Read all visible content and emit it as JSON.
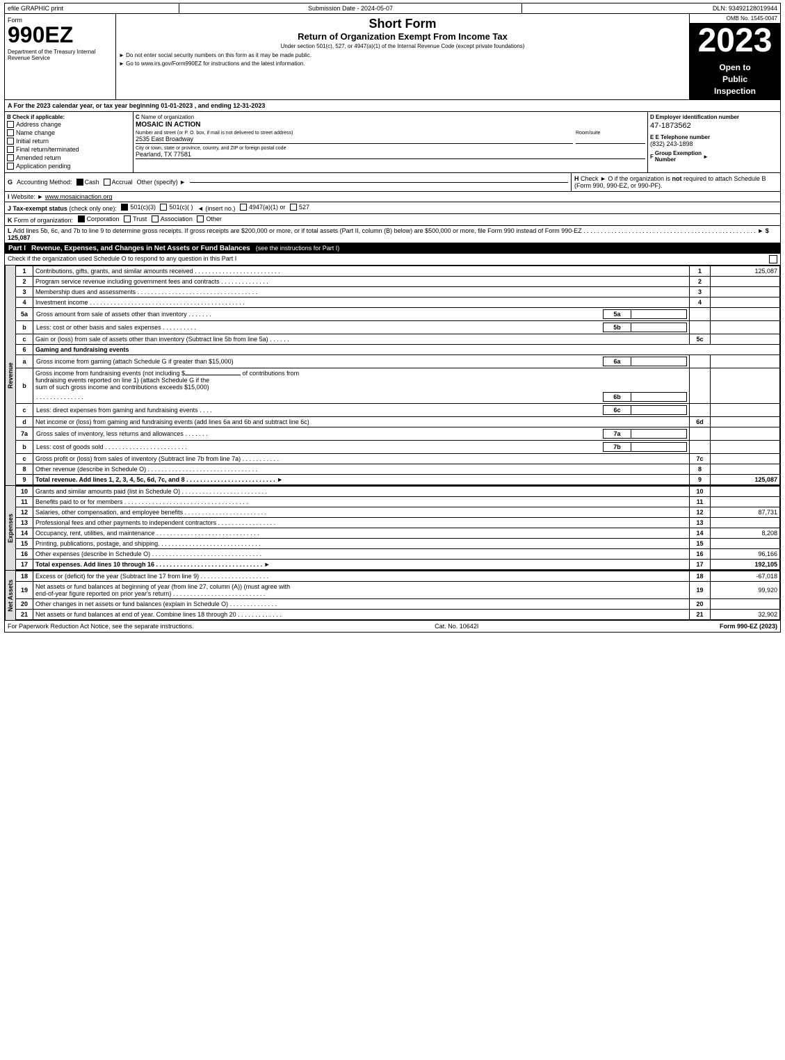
{
  "header": {
    "efile": "efile GRAPHIC print",
    "submission": "Submission Date - 2024-05-07",
    "dln": "DLN: 93492128019944",
    "omb": "OMB No. 1545-0047",
    "form_label": "Form",
    "form_number": "990EZ",
    "short_form": "Short Form",
    "return_title": "Return of Organization Exempt From Income Tax",
    "under_section": "Under section 501(c), 527, or 4947(a)(1) of the Internal Revenue Code (except private foundations)",
    "do_not_enter": "► Do not enter social security numbers on this form as it may be made public.",
    "go_to": "► Go to www.irs.gov/Form990EZ for instructions and the latest information.",
    "year": "2023",
    "open_public": "Open to\nPublic\nInspection",
    "dept": "Department of the Treasury\nInternal Revenue\nService"
  },
  "section_a": {
    "label": "A",
    "text": "For the 2023 calendar year, or tax year beginning 01-01-2023 , and ending 12-31-2023"
  },
  "section_b": {
    "label": "B",
    "title": "Check if applicable:",
    "items": [
      {
        "label": "Address change",
        "checked": false
      },
      {
        "label": "Name change",
        "checked": false
      },
      {
        "label": "Initial return",
        "checked": false
      },
      {
        "label": "Final return/terminated",
        "checked": false
      },
      {
        "label": "Amended return",
        "checked": false
      },
      {
        "label": "Application pending",
        "checked": false
      }
    ]
  },
  "section_c": {
    "label": "C",
    "name_label": "Name of organization",
    "org_name": "MOSAIC IN ACTION",
    "address_label": "Number and street (or P. O. box, if mail is not delivered to street address)",
    "address": "2535 East Broadway",
    "room_label": "Room/suite",
    "room": "",
    "city_label": "City or town, state or province, country, and ZIP or foreign postal code",
    "city": "Pearland, TX  77581"
  },
  "section_d": {
    "label": "D",
    "ein_label": "Employer identification number",
    "ein": "47-1873562",
    "phone_label": "E Telephone number",
    "phone": "(832) 243-1898",
    "group_label": "F Group Exemption\nNumber",
    "group_arrow": "►"
  },
  "section_g": {
    "label": "G",
    "text": "Accounting Method:",
    "cash_label": "Cash",
    "cash_checked": true,
    "accrual_label": "Accrual",
    "accrual_checked": false,
    "other_label": "Other (specify) ►"
  },
  "section_h": {
    "label": "H",
    "text": "Check ►  O if the organization is not required to attach Schedule B\n(Form 990, 990-EZ, or 990-PF)."
  },
  "section_i": {
    "label": "I",
    "text": "Website: ►www.mosaicinaction.org"
  },
  "section_j": {
    "label": "J",
    "text": "Tax-exempt status (check only one):",
    "options": [
      "501(c)(3)",
      "501(c)(  )",
      "(insert no.)",
      "4947(a)(1) or",
      "527"
    ],
    "checked": "501(c)(3)"
  },
  "section_k": {
    "label": "K",
    "text": "Form of organization:",
    "options": [
      "Corporation",
      "Trust",
      "Association",
      "Other"
    ],
    "checked": "Corporation"
  },
  "section_l": {
    "label": "L",
    "text": "Add lines 5b, 6c, and 7b to line 9 to determine gross receipts. If gross receipts are $200,000 or more, or if total assets (Part II, column (B) below) are $500,000 or more, file Form 990 instead of Form 990-EZ",
    "dots": ".",
    "amount": "► $ 125,087"
  },
  "part1": {
    "label": "Part I",
    "title": "Revenue, Expenses, and Changes in Net Assets or Fund Balances",
    "see_instructions": "(see the instructions for Part I)",
    "check_text": "Check if the organization used Schedule O to respond to any question in this Part I",
    "rows": [
      {
        "num": "1",
        "label": "Contributions, gifts, grants, and similar amounts received",
        "line_num": "1",
        "amount": "125,087",
        "shaded": false
      },
      {
        "num": "2",
        "label": "Program service revenue including government fees and contracts",
        "line_num": "2",
        "amount": "",
        "shaded": false
      },
      {
        "num": "3",
        "label": "Membership dues and assessments",
        "line_num": "3",
        "amount": "",
        "shaded": false
      },
      {
        "num": "4",
        "label": "Investment income",
        "line_num": "4",
        "amount": "",
        "shaded": false
      },
      {
        "num": "5a",
        "label": "Gross amount from sale of assets other than inventory",
        "line_num": "5a",
        "amount": "",
        "has_sub": true,
        "shaded": false
      },
      {
        "num": "b",
        "label": "Less: cost or other basis and sales expenses",
        "line_num": "5b",
        "amount": "",
        "has_sub": true,
        "shaded": false
      },
      {
        "num": "c",
        "label": "Gain or (loss) from sale of assets other than inventory (Subtract line 5b from line 5a)",
        "line_num": "5c",
        "amount": "",
        "shaded": false
      },
      {
        "num": "6",
        "label": "Gaming and fundraising events",
        "line_num": "",
        "amount": "",
        "header": true,
        "shaded": false
      },
      {
        "num": "a",
        "label": "Gross income from gaming (attach Schedule G if greater than $15,000)",
        "line_num": "6a",
        "amount": "",
        "has_sub": true,
        "shaded": false
      },
      {
        "num": "b",
        "label": "Gross income from fundraising events (not including $_____ of contributions from fundraising events reported on line 1) (attach Schedule G if the sum of such gross income and contributions exceeds $15,000)",
        "line_num": "6b",
        "amount": "",
        "multiline": true,
        "shaded": false
      },
      {
        "num": "c",
        "label": "Less: direct expenses from gaming and fundraising events",
        "line_num": "6c",
        "amount": "",
        "has_sub": true,
        "shaded": false
      },
      {
        "num": "d",
        "label": "Net income or (loss) from gaming and fundraising events (add lines 6a and 6b and subtract line 6c)",
        "line_num": "6d",
        "amount": "",
        "shaded": false
      },
      {
        "num": "7a",
        "label": "Gross sales of inventory, less returns and allowances",
        "line_num": "7a",
        "amount": "",
        "has_sub": true,
        "shaded": false
      },
      {
        "num": "b",
        "label": "Less: cost of goods sold",
        "line_num": "7b",
        "amount": "",
        "has_sub": true,
        "shaded": false
      },
      {
        "num": "c",
        "label": "Gross profit or (loss) from sales of inventory (Subtract line 7b from line 7a)",
        "line_num": "7c",
        "amount": "",
        "shaded": false
      },
      {
        "num": "8",
        "label": "Other revenue (describe in Schedule O)",
        "line_num": "8",
        "amount": "",
        "shaded": false
      },
      {
        "num": "9",
        "label": "Total revenue. Add lines 1, 2, 3, 4, 5c, 6d, 7c, and 8",
        "line_num": "9",
        "amount": "125,087",
        "bold": true,
        "arrow": true,
        "shaded": false
      }
    ],
    "side_label": "Revenue"
  },
  "part1_expenses": {
    "rows": [
      {
        "num": "10",
        "label": "Grants and similar amounts paid (list in Schedule O)",
        "line_num": "10",
        "amount": "",
        "shaded": false
      },
      {
        "num": "11",
        "label": "Benefits paid to or for members",
        "line_num": "11",
        "amount": "",
        "shaded": false
      },
      {
        "num": "12",
        "label": "Salaries, other compensation, and employee benefits",
        "line_num": "12",
        "amount": "87,731",
        "shaded": false
      },
      {
        "num": "13",
        "label": "Professional fees and other payments to independent contractors",
        "line_num": "13",
        "amount": "",
        "shaded": false
      },
      {
        "num": "14",
        "label": "Occupancy, rent, utilities, and maintenance",
        "line_num": "14",
        "amount": "8,208",
        "shaded": false
      },
      {
        "num": "15",
        "label": "Printing, publications, postage, and shipping",
        "line_num": "15",
        "amount": "",
        "shaded": false
      },
      {
        "num": "16",
        "label": "Other expenses (describe in Schedule O)",
        "line_num": "16",
        "amount": "96,166",
        "shaded": false
      },
      {
        "num": "17",
        "label": "Total expenses. Add lines 10 through 16",
        "line_num": "17",
        "amount": "192,105",
        "bold": true,
        "arrow": true,
        "shaded": false
      }
    ],
    "side_label": "Expenses"
  },
  "part1_netassets": {
    "rows": [
      {
        "num": "18",
        "label": "Excess or (deficit) for the year (Subtract line 17 from line 9)",
        "line_num": "18",
        "amount": "-67,018",
        "shaded": false
      },
      {
        "num": "19",
        "label": "Net assets or fund balances at beginning of year (from line 27, column (A)) (must agree with end-of-year figure reported on prior year's return)",
        "line_num": "19",
        "amount": "99,920",
        "shaded": false
      },
      {
        "num": "20",
        "label": "Other changes in net assets or fund balances (explain in Schedule O)",
        "line_num": "20",
        "amount": "",
        "shaded": false
      },
      {
        "num": "21",
        "label": "Net assets or fund balances at end of year. Combine lines 18 through 20",
        "line_num": "21",
        "amount": "32,902",
        "shaded": false
      }
    ],
    "side_label": "Net Assets"
  },
  "footer": {
    "left": "For Paperwork Reduction Act Notice, see the separate instructions.",
    "center": "Cat. No. 10642I",
    "right": "Form 990-EZ (2023)"
  }
}
